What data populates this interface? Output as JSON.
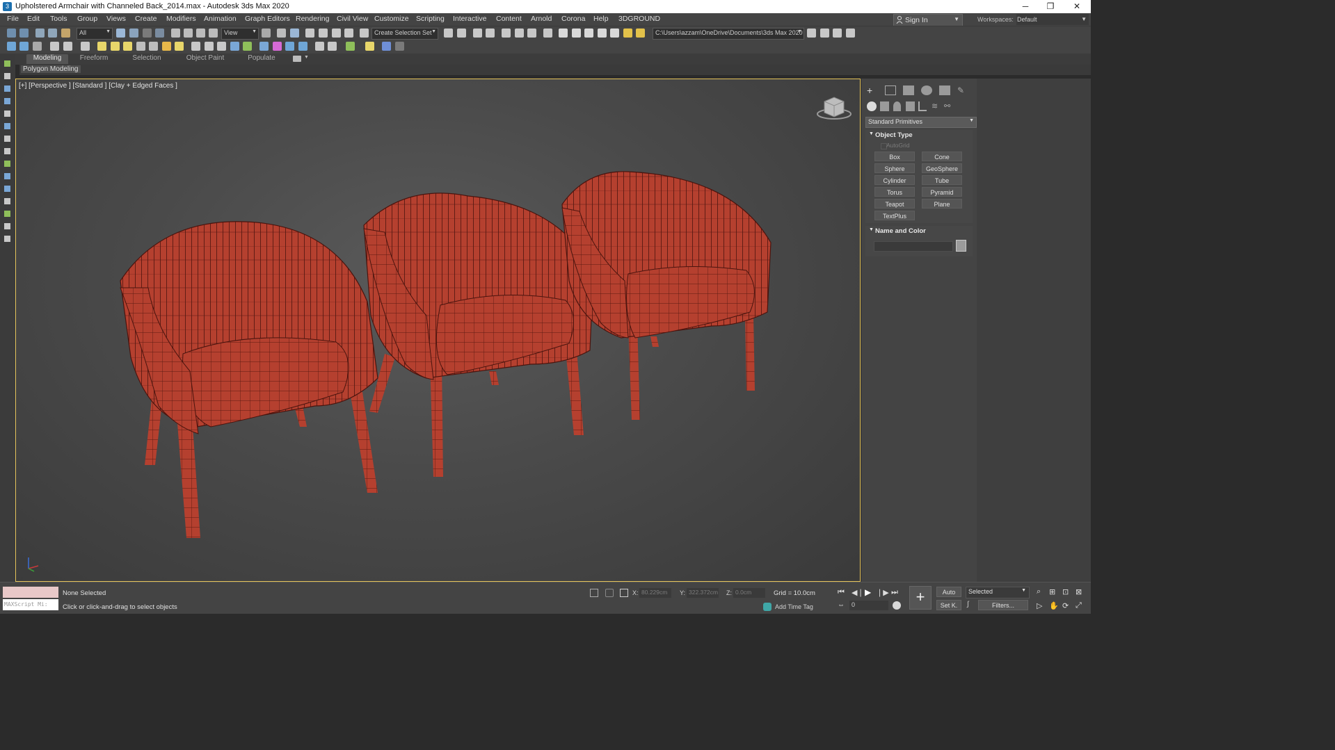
{
  "window": {
    "title": "Upholstered Armchair with Channeled Back_2014.max - Autodesk 3ds Max 2020",
    "app_icon": "3",
    "minimize": "─",
    "maximize": "❐",
    "close": "✕"
  },
  "menu": [
    "File",
    "Edit",
    "Tools",
    "Group",
    "Views",
    "Create",
    "Modifiers",
    "Animation",
    "Graph Editors",
    "Rendering",
    "Civil View",
    "Customize",
    "Scripting",
    "Interactive",
    "Content",
    "Arnold",
    "Corona",
    "Help",
    "3DGROUND"
  ],
  "account": {
    "sign_in": "Sign In",
    "workspaces_label": "Workspaces:",
    "workspace": "Default"
  },
  "toolbar": {
    "selection_filter": "All",
    "reference_coord": "View",
    "create_selection_set": "Create Selection Set",
    "project_path": "C:\\Users\\azzam\\OneDrive\\Documents\\3ds Max 2020"
  },
  "ribbon": {
    "tabs": [
      "Modeling",
      "Freeform",
      "Selection",
      "Object Paint",
      "Populate"
    ],
    "active_tab": "Modeling",
    "panel": "Polygon Modeling"
  },
  "viewport": {
    "label": "[+] [Perspective ] [Standard ] [Clay + Edged Faces ]",
    "chair_color": "#b5402f",
    "wire_color": "#5a1a12",
    "border_color": "#e6c45a"
  },
  "command_panel": {
    "category": "Standard Primitives",
    "object_type_title": "Object Type",
    "autogrid": "AutoGrid",
    "buttons": [
      "Box",
      "Cone",
      "Sphere",
      "GeoSphere",
      "Cylinder",
      "Tube",
      "Torus",
      "Pyramid",
      "Teapot",
      "Plane",
      "TextPlus"
    ],
    "name_color_title": "Name and Color",
    "object_color": "#9b9b9b"
  },
  "status": {
    "maxscript": "MAXScript Mi:",
    "selection": "None Selected",
    "prompt": "Click or click-and-drag to select objects",
    "x_label": "X:",
    "x_value": "80.229cm",
    "y_label": "Y:",
    "y_value": "322.372cm",
    "z_label": "Z:",
    "z_value": "0.0cm",
    "grid": "Grid = 10.0cm",
    "add_time_tag": "Add Time Tag",
    "auto_key": "Auto",
    "set_key": "Set K.",
    "key_filter": "Selected",
    "filters": "Filters...",
    "frame": "0"
  }
}
